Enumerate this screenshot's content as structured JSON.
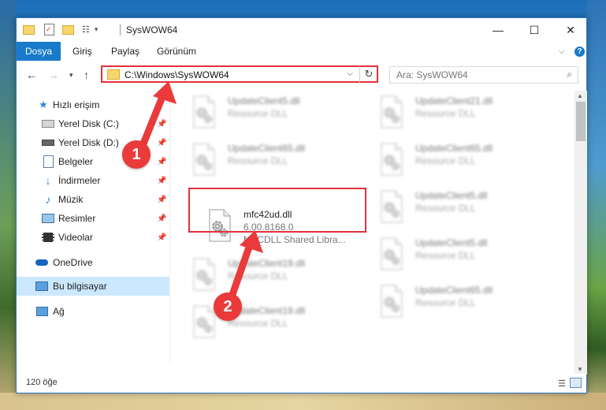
{
  "window": {
    "title": "SysWOW64",
    "controls": {
      "minimize": "—",
      "maximize": "☐",
      "close": "✕"
    }
  },
  "ribbon": {
    "tabs": [
      "Dosya",
      "Giriş",
      "Paylaş",
      "Görünüm"
    ]
  },
  "navigation": {
    "address": "C:\\Windows\\SysWOW64",
    "search_placeholder": "Ara: SysWOW64"
  },
  "sidebar": {
    "items": [
      {
        "label": "Hızlı erişim",
        "icon": "star-icon",
        "pinned": false
      },
      {
        "label": "Yerel Disk (C:)",
        "icon": "drive-icon",
        "pinned": true
      },
      {
        "label": "Yerel Disk (D:)",
        "icon": "drive-icon",
        "pinned": true
      },
      {
        "label": "Belgeler",
        "icon": "documents-icon",
        "pinned": true
      },
      {
        "label": "İndirmeler",
        "icon": "download-icon",
        "pinned": true
      },
      {
        "label": "Müzik",
        "icon": "music-icon",
        "pinned": true
      },
      {
        "label": "Resimler",
        "icon": "pictures-icon",
        "pinned": true
      },
      {
        "label": "Videolar",
        "icon": "video-icon",
        "pinned": true
      },
      {
        "label": "OneDrive",
        "icon": "cloud-icon",
        "pinned": false
      },
      {
        "label": "Bu bilgisayar",
        "icon": "computer-icon",
        "pinned": false
      },
      {
        "label": "Ağ",
        "icon": "network-icon",
        "pinned": false
      }
    ]
  },
  "files": {
    "left": [
      {
        "name": "UpdateClient5.dll",
        "desc": "Resource DLL"
      },
      {
        "name": "UpdateClient65.dll",
        "desc": "Resource DLL"
      },
      {
        "name": "mfc42ud.dll",
        "version": "6.00.8168.0",
        "desc": "MFCDLL Shared Libra..."
      },
      {
        "name": "UpdateClient19.dll",
        "desc": "Resource DLL"
      },
      {
        "name": "UpdateClient19.dll",
        "desc": "Resource DLL"
      }
    ],
    "right": [
      {
        "name": "UpdateClient21.dll",
        "desc": "Resource DLL"
      },
      {
        "name": "UpdateClient65.dll",
        "desc": "Resource DLL"
      },
      {
        "name": "UpdateClient5.dll",
        "desc": "Resource DLL"
      },
      {
        "name": "UpdateClient5.dll",
        "desc": "Resource DLL"
      },
      {
        "name": "UpdateClient65.dll",
        "desc": "Resource DLL"
      }
    ]
  },
  "status": {
    "item_count": "120 öğe"
  },
  "annotations": {
    "step1": "1",
    "step2": "2"
  },
  "colors": {
    "accent": "#1979ca",
    "highlight": "#e3313b",
    "selection": "#cce8ff"
  }
}
